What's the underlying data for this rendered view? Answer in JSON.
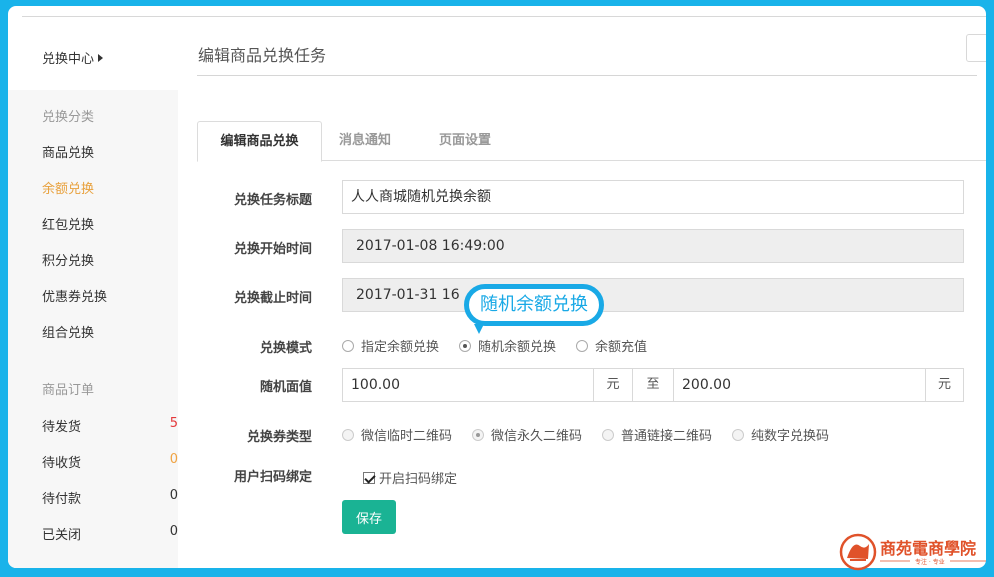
{
  "sidebar": {
    "header": "兑换中心",
    "category_title": "兑换分类",
    "items": [
      {
        "label": "商品兑换",
        "active": false
      },
      {
        "label": "余额兑换",
        "active": true
      },
      {
        "label": "红包兑换",
        "active": false
      },
      {
        "label": "积分兑换",
        "active": false
      },
      {
        "label": "优惠券兑换",
        "active": false
      },
      {
        "label": "组合兑换",
        "active": false
      }
    ],
    "orders_title": "商品订单",
    "orders": [
      {
        "label": "待发货",
        "count": "5"
      },
      {
        "label": "待收货",
        "count": "0"
      },
      {
        "label": "待付款",
        "count": "0"
      },
      {
        "label": "已关闭",
        "count": "0"
      }
    ]
  },
  "page": {
    "title": "编辑商品兑换任务"
  },
  "tabs": [
    {
      "label": "编辑商品兑换",
      "active": true
    },
    {
      "label": "消息通知",
      "active": false
    },
    {
      "label": "页面设置",
      "active": false
    }
  ],
  "form": {
    "title_label": "兑换任务标题",
    "title_value": "人人商城随机兑换余额",
    "start_label": "兑换开始时间",
    "start_value": "2017-01-08 16:49:00",
    "end_label": "兑换截止时间",
    "end_value": "2017-01-31 16",
    "mode_label": "兑换模式",
    "mode_options": [
      {
        "label": "指定余额兑换",
        "checked": false
      },
      {
        "label": "随机余额兑换",
        "checked": true
      },
      {
        "label": "余额充值",
        "checked": false
      }
    ],
    "amount_label": "随机面值",
    "amount_min": "100.00",
    "amount_unit_1": "元",
    "amount_to": "至",
    "amount_max": "200.00",
    "amount_unit_2": "元",
    "coupon_label": "兑换券类型",
    "coupon_options": [
      {
        "label": "微信临时二维码",
        "checked": false
      },
      {
        "label": "微信永久二维码",
        "checked": true
      },
      {
        "label": "普通链接二维码",
        "checked": false
      },
      {
        "label": "纯数字兑换码",
        "checked": false
      }
    ],
    "bind_label": "用户扫码绑定",
    "bind_option": "开启扫码绑定",
    "save_label": "保存"
  },
  "callout": {
    "text": "随机余额兑换"
  },
  "logo": {
    "text": "商苑電商學院",
    "tagline": "专注 · 专业"
  },
  "colors": {
    "frame_border": "#19b3ea",
    "active_item": "#e8a13d",
    "save_button": "#1ab394",
    "callout": "#19a9e6",
    "count_red": "#e4393c",
    "count_orange": "#f0a342",
    "logo": "#e0522a"
  }
}
